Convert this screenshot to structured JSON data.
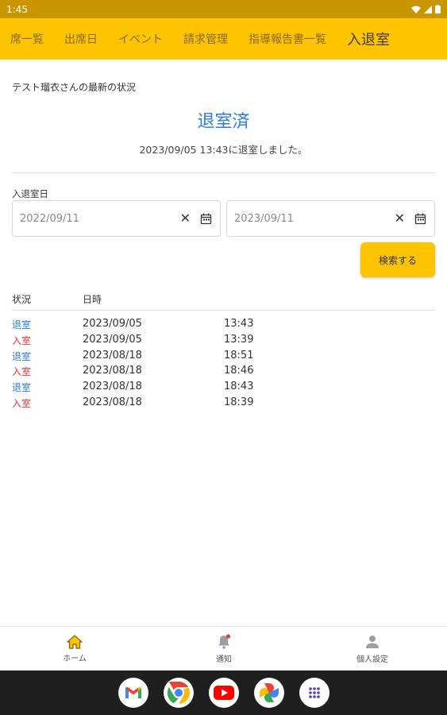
{
  "status_bar": {
    "time": "1:45"
  },
  "tabs": [
    {
      "label": "席一覧"
    },
    {
      "label": "出席日"
    },
    {
      "label": "イベント"
    },
    {
      "label": "請求管理"
    },
    {
      "label": "指導報告書一覧"
    },
    {
      "label": "入退室"
    }
  ],
  "status": {
    "caption": "テスト瑠衣さんの最新の状況",
    "main": "退室済",
    "message": "2023/09/05 13:43に退室しました。"
  },
  "filter": {
    "label": "入退室日",
    "from_value": "2022/09/11",
    "to_value": "2023/09/11",
    "search_label": "検索する"
  },
  "table": {
    "headers": {
      "status": "状況",
      "datetime": "日時"
    },
    "rows": [
      {
        "status": "退室",
        "date": "2023/09/05",
        "time": "13:43"
      },
      {
        "status": "入室",
        "date": "2023/09/05",
        "time": "13:39"
      },
      {
        "status": "退室",
        "date": "2023/08/18",
        "time": "18:51"
      },
      {
        "status": "入室",
        "date": "2023/08/18",
        "time": "18:46"
      },
      {
        "status": "退室",
        "date": "2023/08/18",
        "time": "18:43"
      },
      {
        "status": "入室",
        "date": "2023/08/18",
        "time": "18:39"
      }
    ]
  },
  "bottom_nav": [
    {
      "label": "ホーム",
      "icon": "home-icon"
    },
    {
      "label": "通知",
      "icon": "bell-icon"
    },
    {
      "label": "個人設定",
      "icon": "person-icon"
    }
  ],
  "system_bar_apps": [
    "gmail-icon",
    "chrome-icon",
    "youtube-icon",
    "photos-icon",
    "app-drawer-icon"
  ],
  "colors": {
    "accent": "#ffc400",
    "status_bar": "#c99600",
    "exit": "#2a7ae2",
    "enter": "#e53935"
  }
}
